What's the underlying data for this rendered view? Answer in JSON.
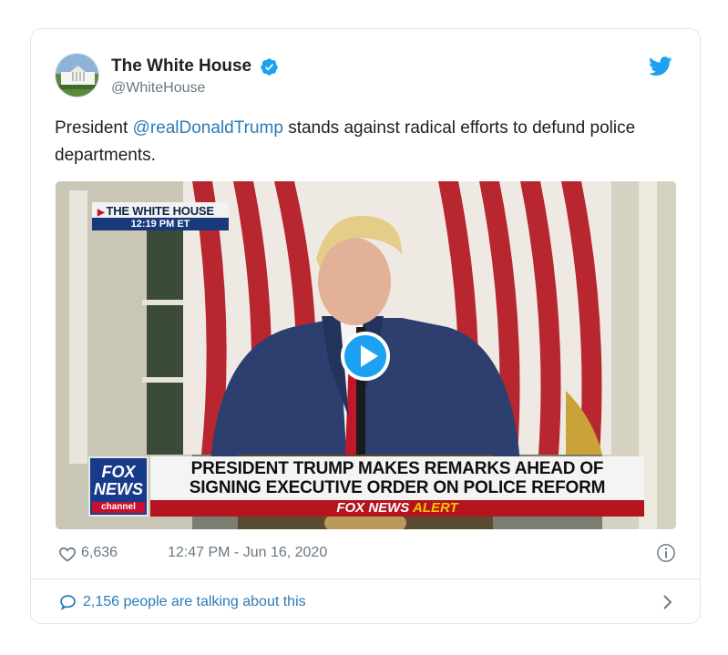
{
  "account": {
    "display_name": "The White House",
    "handle": "@WhiteHouse",
    "verified_icon": "verified-badge-icon",
    "platform_icon": "twitter-bird-icon"
  },
  "tweet": {
    "text_before": "President ",
    "mention": "@realDonaldTrump",
    "text_after": " stands against radical efforts to defund police departments."
  },
  "media": {
    "location_tag": "THE WHITE HOUSE",
    "location_time": "12:19 PM ET",
    "logo_line1": "FOX",
    "logo_line2": "NEWS",
    "logo_line3": "channel",
    "headline_line1": "PRESIDENT TRUMP MAKES REMARKS AHEAD OF",
    "headline_line2": "SIGNING EXECUTIVE ORDER ON POLICE REFORM",
    "alert_brand": "FOX NEWS",
    "alert_word": "ALERT",
    "play_icon": "play-icon"
  },
  "meta": {
    "likes": "6,636",
    "timestamp": "12:47 PM - Jun 16, 2020"
  },
  "footer": {
    "talking_label": "2,156 people are talking about this"
  },
  "colors": {
    "link": "#2b7bb9",
    "muted": "#697882",
    "twitter_blue": "#1da1f2",
    "border": "#e1e8ed"
  }
}
